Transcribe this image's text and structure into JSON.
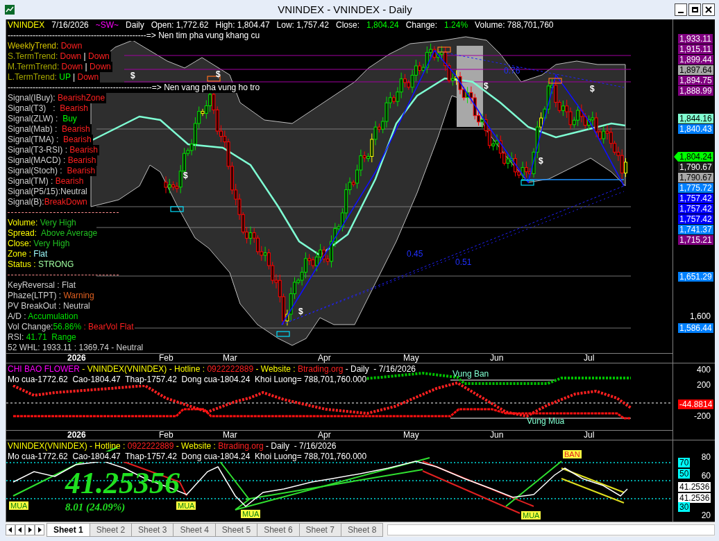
{
  "window": {
    "title": "VNINDEX - VNINDEX - Daily"
  },
  "main_pane": {
    "header": [
      {
        "text": "VNINDEX",
        "color": "#ffff00"
      },
      {
        "text": "7/16/2026",
        "color": "#ffffff"
      },
      {
        "text": "~SW~",
        "color": "#ff00ff"
      },
      {
        "text": "Daily",
        "color": "#ffffff"
      },
      {
        "text": "Open: 1,772.62",
        "color": "#ffffff"
      },
      {
        "text": "High: 1,804.47",
        "color": "#ffffff"
      },
      {
        "text": "Low: 1,757.42",
        "color": "#ffffff"
      },
      {
        "text": "Close:",
        "color": "#ffffff"
      },
      {
        "text": "1,804.24",
        "color": "#00ff00"
      },
      {
        "text": "Change:",
        "color": "#ffffff"
      },
      {
        "text": "1.24%",
        "color": "#00ff00"
      },
      {
        "text": "Volume: 788,701,760",
        "color": "#ffffff"
      }
    ],
    "info_panel": [
      {
        "kind": "note",
        "segments": [
          {
            "text": "--------------------------------------------------=> Nen tim pha vung khang cu"
          }
        ]
      },
      {
        "kind": "text",
        "segments": [
          {
            "text": "WeeklyTrend: ",
            "color": "#d4c400"
          },
          {
            "text": "Down",
            "color": "#ff2020"
          }
        ]
      },
      {
        "kind": "text",
        "segments": [
          {
            "text": "S.TermTrend: ",
            "color": "#a8a800"
          },
          {
            "text": "Down",
            "color": "#ff2020"
          },
          {
            "text": " | "
          },
          {
            "text": "Down",
            "color": "#ff2020"
          }
        ]
      },
      {
        "kind": "text",
        "segments": [
          {
            "text": "M.TermTrend: ",
            "color": "#a8a800"
          },
          {
            "text": "Down",
            "color": "#ff2020"
          },
          {
            "text": " | "
          },
          {
            "text": "Down",
            "color": "#ff2020"
          }
        ]
      },
      {
        "kind": "text",
        "segments": [
          {
            "text": "L.TermTrend: ",
            "color": "#a8a800"
          },
          {
            "text": "UP",
            "color": "#00ff00"
          },
          {
            "text": " | "
          },
          {
            "text": "Down",
            "color": "#ff2020"
          }
        ]
      },
      {
        "kind": "note",
        "segments": [
          {
            "text": "----------------------------------------------------=> Nen vang pha vung ho tro"
          }
        ]
      },
      {
        "kind": "text",
        "segments": [
          {
            "text": "Signal(IBuy): ",
            "color": "#d0d0d0"
          },
          {
            "text": "BearishZone",
            "color": "#ff2020"
          }
        ]
      },
      {
        "kind": "text",
        "segments": [
          {
            "text": "Signal(T3)   :  ",
            "color": "#d0d0d0"
          },
          {
            "text": "Bearish",
            "color": "#ff2020"
          }
        ]
      },
      {
        "kind": "text",
        "segments": [
          {
            "text": "Signal(ZLW) :  ",
            "color": "#d0d0d0"
          },
          {
            "text": "Buy",
            "color": "#00ff00"
          }
        ]
      },
      {
        "kind": "text",
        "segments": [
          {
            "text": "Signal(Mab) :  ",
            "color": "#d0d0d0"
          },
          {
            "text": "Bearish",
            "color": "#ff2020"
          }
        ]
      },
      {
        "kind": "text",
        "segments": [
          {
            "text": "Signal(TMA) :  ",
            "color": "#d0d0d0"
          },
          {
            "text": "Bearish",
            "color": "#ff2020"
          }
        ]
      },
      {
        "kind": "text",
        "segments": [
          {
            "text": "Signal(T3-RSI) : ",
            "color": "#d0d0d0"
          },
          {
            "text": "Bearish",
            "color": "#ff2020"
          }
        ]
      },
      {
        "kind": "text",
        "segments": [
          {
            "text": "Signal(MACD) : ",
            "color": "#d0d0d0"
          },
          {
            "text": "Bearish",
            "color": "#ff2020"
          }
        ]
      },
      {
        "kind": "text",
        "segments": [
          {
            "text": "Signal(Stoch) :  ",
            "color": "#d0d0d0"
          },
          {
            "text": "Bearish",
            "color": "#ff2020"
          }
        ]
      },
      {
        "kind": "text",
        "segments": [
          {
            "text": "Signal(TM) : ",
            "color": "#d0d0d0"
          },
          {
            "text": "Bearish",
            "color": "#ff2020"
          }
        ]
      },
      {
        "kind": "text",
        "segments": [
          {
            "text": "Signal(P5/15):Neutral",
            "color": "#d0d0d0"
          }
        ]
      },
      {
        "kind": "text",
        "segments": [
          {
            "text": "Signal(B):",
            "color": "#d0d0d0"
          },
          {
            "text": "BreakDown",
            "color": "#ff2020"
          }
        ]
      },
      {
        "kind": "rule"
      },
      {
        "kind": "text",
        "segments": [
          {
            "text": "Volume: ",
            "color": "#ffff00"
          },
          {
            "text": "Very High",
            "color": "#20c020"
          }
        ]
      },
      {
        "kind": "text",
        "segments": [
          {
            "text": "Spread:  ",
            "color": "#ffff00"
          },
          {
            "text": "Above Average",
            "color": "#20c020"
          }
        ]
      },
      {
        "kind": "text",
        "segments": [
          {
            "text": "Close: ",
            "color": "#ffff00"
          },
          {
            "text": "Very High",
            "color": "#20c020"
          }
        ]
      },
      {
        "kind": "text",
        "segments": [
          {
            "text": "Zone : ",
            "color": "#ffff00"
          },
          {
            "text": "Flat",
            "color": "#a0ffff"
          }
        ]
      },
      {
        "kind": "text",
        "segments": [
          {
            "text": "Status : ",
            "color": "#ffff00"
          },
          {
            "text": "STRONG",
            "color": "#a0ffa0"
          }
        ]
      },
      {
        "kind": "rule"
      },
      {
        "kind": "text",
        "segments": [
          {
            "text": "KeyReversal : Flat",
            "color": "#d0d0d0"
          }
        ]
      },
      {
        "kind": "text",
        "segments": [
          {
            "text": "Phaze(LTPT) : ",
            "color": "#d0d0d0"
          },
          {
            "text": "Warning",
            "color": "#e06020"
          }
        ]
      },
      {
        "kind": "text",
        "segments": [
          {
            "text": "PV BreakOut : Neutral",
            "color": "#d0d0d0"
          }
        ]
      },
      {
        "kind": "text",
        "segments": [
          {
            "text": "A/D : ",
            "color": "#d0d0d0"
          },
          {
            "text": "Accumulation",
            "color": "#00e000"
          }
        ]
      },
      {
        "kind": "text",
        "segments": [
          {
            "text": "Vol Change:",
            "color": "#d0d0d0"
          },
          {
            "text": "56.86%",
            "color": "#00e000"
          },
          {
            "text": " : BearVol Flat",
            "color": "#ff2020"
          }
        ]
      },
      {
        "kind": "text",
        "segments": [
          {
            "text": "RSI: ",
            "color": "#d0d0d0"
          },
          {
            "text": "41.71  Range",
            "color": "#00e000"
          }
        ]
      },
      {
        "kind": "text",
        "segments": [
          {
            "text": "52 WHL: 1933.11 : 1369.74 - Neutral",
            "color": "#d0d0d0"
          }
        ]
      }
    ],
    "chart_marks": [
      "$",
      "$",
      "$",
      "$",
      "$",
      "$",
      "$"
    ],
    "fib_labels": [
      "0.76",
      "0.45",
      "0.51"
    ],
    "scale": [
      {
        "kind": "tag",
        "text": "1,933.11",
        "color": "#800080"
      },
      {
        "kind": "tag",
        "text": "1,915.11",
        "color": "#800080"
      },
      {
        "kind": "tag",
        "text": "1,899.44",
        "color": "#800080"
      },
      {
        "kind": "tag",
        "text": "1,897.64",
        "color": "#a8a8a8"
      },
      {
        "kind": "tag",
        "text": "1,894.75",
        "color": "#800080"
      },
      {
        "kind": "tag",
        "text": "1,888.99",
        "color": "#800080"
      },
      {
        "kind": "tag",
        "text": "1,844.16",
        "color": "#80ffd0"
      },
      {
        "kind": "tag",
        "text": "1,840.43",
        "color": "#0080ff"
      },
      {
        "kind": "current",
        "text": "1,804.24",
        "color": "#00ff00"
      },
      {
        "kind": "tag",
        "text": "1,790.67",
        "color": "#202020"
      },
      {
        "kind": "tag",
        "text": "1,790.67",
        "color": "#a8a8a8"
      },
      {
        "kind": "tag",
        "text": "1,775.72",
        "color": "#0080ff"
      },
      {
        "kind": "tag",
        "text": "1,757.42",
        "color": "#0000ff"
      },
      {
        "kind": "tag",
        "text": "1,757.42",
        "color": "#0000ff"
      },
      {
        "kind": "tag",
        "text": "1,757.42",
        "color": "#0000ff"
      },
      {
        "kind": "tag",
        "text": "1,741.37",
        "color": "#0080ff"
      },
      {
        "kind": "tag",
        "text": "1,715.21",
        "color": "#800080"
      },
      {
        "kind": "tag",
        "text": "1,651.29",
        "color": "#0080ff"
      },
      {
        "kind": "tick",
        "text": "1,600"
      },
      {
        "kind": "tag",
        "text": "1,586.44",
        "color": "#0080ff"
      }
    ],
    "months": [
      {
        "text": "2026",
        "bold": true
      },
      {
        "text": "Feb",
        "bold": false
      },
      {
        "text": "Mar",
        "bold": false
      },
      {
        "text": "Apr",
        "bold": false
      },
      {
        "text": "May",
        "bold": false
      },
      {
        "text": "Jun",
        "bold": false
      },
      {
        "text": "Jul",
        "bold": false
      }
    ]
  },
  "flower_pane": {
    "header": [
      {
        "text": "CHI BAO FLOWER",
        "color": "#ff00ff"
      },
      {
        "text": " - VNINDEX(VNINDEX) - Hotline : ",
        "color": "#ffff00"
      },
      {
        "text": "0922222889",
        "color": "#ff2020"
      },
      {
        "text": " - Website : ",
        "color": "#ffff00"
      },
      {
        "text": "Btrading.org",
        "color": "#ff2020"
      },
      {
        "text": " - Daily  - 7/16/2026"
      }
    ],
    "quote": "Mo cua-1772.62  Cao-1804.47  Thap-1757.42  Dong cua-1804.24  Khoi Luong= 788,701,760.000",
    "labels": [
      "Vung Ban",
      "Vung Mua"
    ],
    "scale": [
      {
        "kind": "tick",
        "text": "400"
      },
      {
        "kind": "tick",
        "text": "200"
      },
      {
        "kind": "tag",
        "text": "-44.8814",
        "color": "#ff0000"
      },
      {
        "kind": "tick",
        "text": "-200"
      }
    ],
    "months": [
      {
        "text": "2026",
        "bold": true
      },
      {
        "text": "Feb",
        "bold": false
      },
      {
        "text": "Mar",
        "bold": false
      },
      {
        "text": "Apr",
        "bold": false
      },
      {
        "text": "May",
        "bold": false
      },
      {
        "text": "Jun",
        "bold": false
      },
      {
        "text": "Jul",
        "bold": false
      }
    ]
  },
  "rsi_pane": {
    "header": [
      {
        "text": "VNINDEX(VNINDEX) - Hotline : ",
        "color": "#ffff00"
      },
      {
        "text": "0922222889",
        "color": "#ff2020"
      },
      {
        "text": " - Website : ",
        "color": "#ffff00"
      },
      {
        "text": "Btrading.org",
        "color": "#ff2020"
      },
      {
        "text": " - Daily  - 7/16/2026",
        "color": "#ffffff"
      }
    ],
    "quote": "Mo cua-1772.62  Cao-1804.47  Thap-1757.42  Dong cua-1804.24  Khoi Luong= 788,701,760.000",
    "value": "41.25356",
    "change": "8.01 (24.09%)",
    "signals": [
      {
        "kind": "buy",
        "text": "MUA"
      },
      {
        "kind": "buy",
        "text": "MUA"
      },
      {
        "kind": "buy",
        "text": "MUA"
      },
      {
        "kind": "buy",
        "text": "MUA"
      },
      {
        "kind": "sell",
        "text": "BAN"
      }
    ],
    "scale": [
      {
        "kind": "tick",
        "text": "80"
      },
      {
        "kind": "tag",
        "text": "70",
        "color": "#00ffff"
      },
      {
        "kind": "tag",
        "text": "50",
        "color": "#00ffff"
      },
      {
        "kind": "tick",
        "text": "60"
      },
      {
        "kind": "tag",
        "text": "41.2536",
        "color": "#ffffff"
      },
      {
        "kind": "tag",
        "text": "41.2536",
        "color": "#ffffff"
      },
      {
        "kind": "tag",
        "text": "30",
        "color": "#00ffff"
      },
      {
        "kind": "tick",
        "text": "20"
      }
    ]
  },
  "sheet_tabs": [
    {
      "label": "Sheet 1",
      "selected": true
    },
    {
      "label": "Sheet 2",
      "selected": false
    },
    {
      "label": "Sheet 3",
      "selected": false
    },
    {
      "label": "Sheet 4",
      "selected": false
    },
    {
      "label": "Sheet 5",
      "selected": false
    },
    {
      "label": "Sheet 6",
      "selected": false
    },
    {
      "label": "Sheet 7",
      "selected": false
    },
    {
      "label": "Sheet 8",
      "selected": false
    }
  ]
}
